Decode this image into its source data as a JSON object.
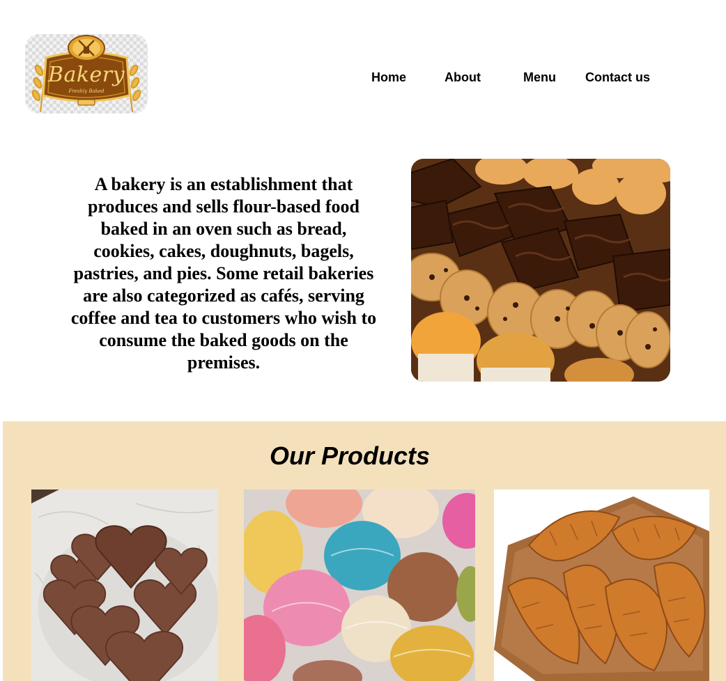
{
  "brand": {
    "logo_wordmark": "Bakery",
    "logo_tagline": "Freshly Baked",
    "colors": {
      "logo_gold": "#c78a1f",
      "logo_brown": "#7a3f0c",
      "products_bg": "#f4e1bc"
    }
  },
  "nav": {
    "items": [
      {
        "label": "Home"
      },
      {
        "label": "About"
      },
      {
        "label": "Menu"
      },
      {
        "label": "Contact us"
      }
    ]
  },
  "intro": {
    "text": "A bakery is an establishment that produces and sells flour-based food baked in an oven such as bread, cookies, cakes, doughnuts, bagels, pastries, and pies. Some retail bakeries are also categorized as cafés, serving coffee and tea to customers who wish to consume the baked goods on the premises.",
    "image_icon": "pastry-assortment-photo"
  },
  "products": {
    "title": "Our Products",
    "items": [
      {
        "image_icon": "chocolate-heart-cookies-photo"
      },
      {
        "image_icon": "macarons-photo"
      },
      {
        "image_icon": "croissants-photo"
      }
    ]
  }
}
